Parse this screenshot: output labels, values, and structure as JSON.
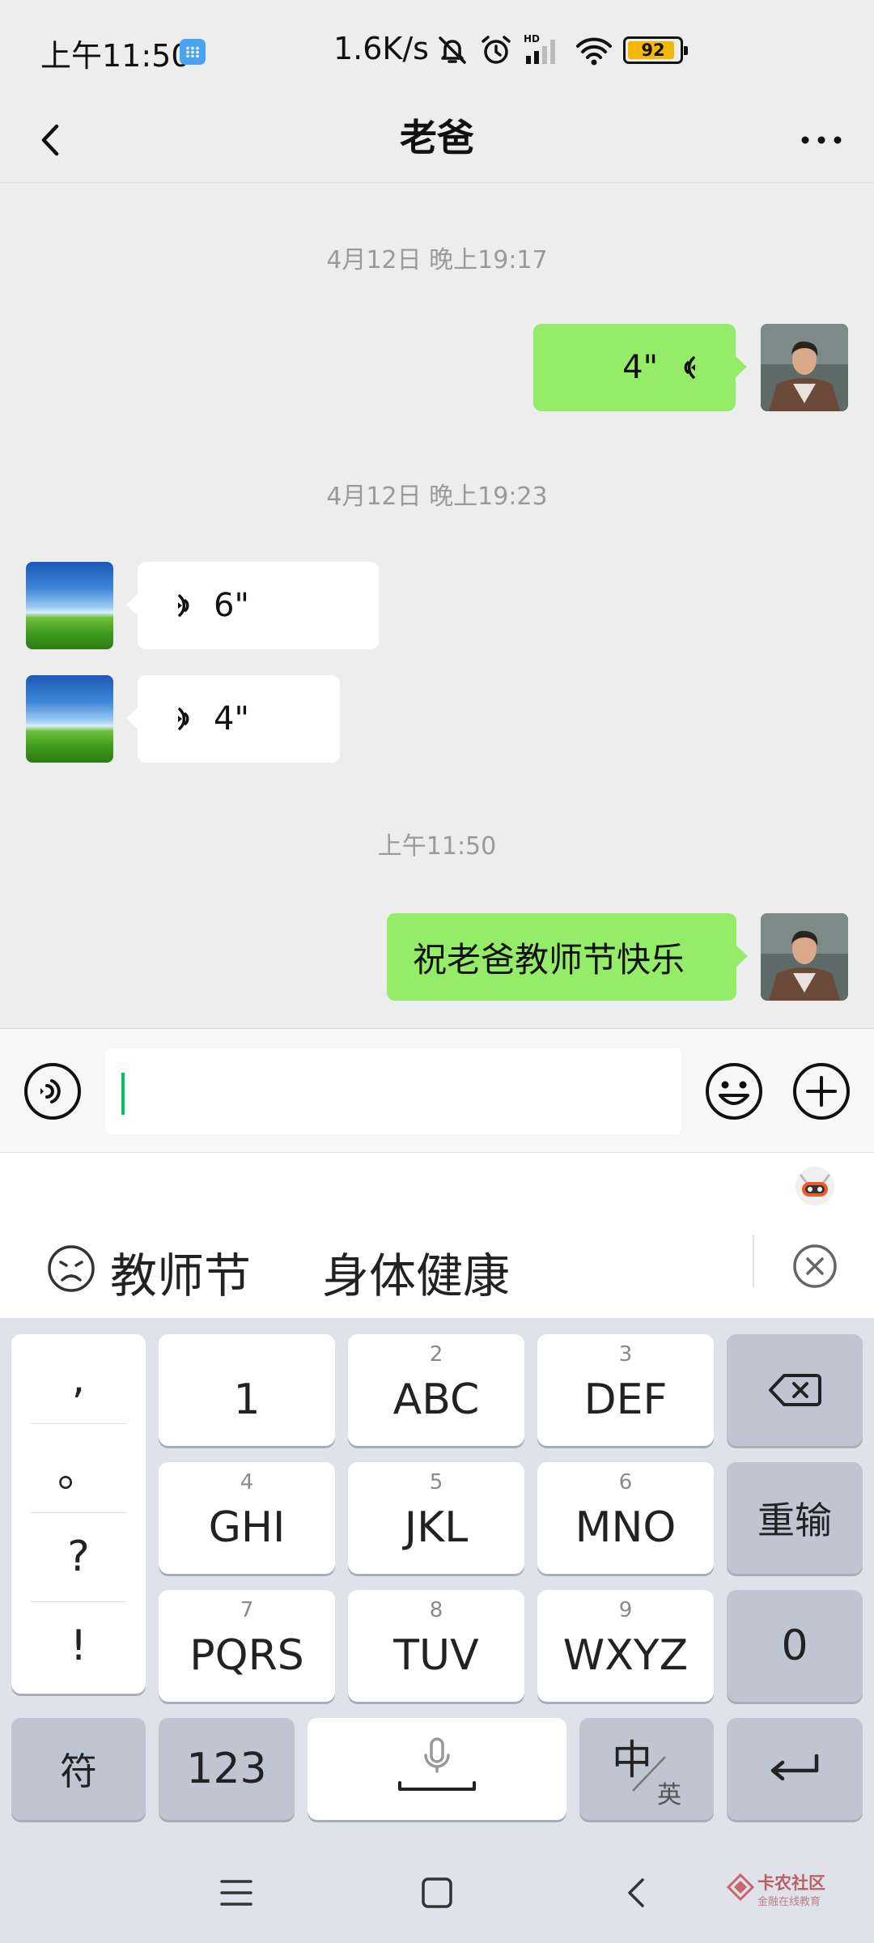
{
  "status_bar": {
    "time": "上午11:50",
    "network_speed": "1.6K/s",
    "battery": "92",
    "battery_level_percent": 92,
    "icons": [
      "keyboard-app-icon",
      "mute-icon",
      "alarm-icon",
      "hd-icon",
      "signal-icon",
      "wifi-icon",
      "battery-icon"
    ]
  },
  "header": {
    "title": "老爸"
  },
  "messages": {
    "ts1": "4月12日 晚上19:17",
    "m1_duration": "4\"",
    "ts2": "4月12日 晚上19:23",
    "m2_duration": "6\"",
    "m3_duration": "4\"",
    "ts3": "上午11:50",
    "m4_text": "祝老爸教师节快乐"
  },
  "input_bar": {
    "value": ""
  },
  "candidates": {
    "c1": "教师节",
    "c2": "身体健康"
  },
  "keyboard": {
    "punct": [
      ",",
      "。",
      "?",
      "!"
    ],
    "keys": [
      {
        "num": "",
        "letters": "1"
      },
      {
        "num": "2",
        "letters": "ABC"
      },
      {
        "num": "3",
        "letters": "DEF"
      },
      {
        "num": "4",
        "letters": "GHI"
      },
      {
        "num": "5",
        "letters": "JKL"
      },
      {
        "num": "6",
        "letters": "MNO"
      },
      {
        "num": "7",
        "letters": "PQRS"
      },
      {
        "num": "8",
        "letters": "TUV"
      },
      {
        "num": "9",
        "letters": "WXYZ"
      }
    ],
    "reenter": "重输",
    "zero": "0",
    "symbols": "符",
    "numbers": "123",
    "lang_main": "中",
    "lang_sub": "英"
  },
  "watermark": {
    "line1": "卡农社区",
    "line2": "金融在线教育"
  },
  "colors": {
    "bubble_sent": "#95ec69",
    "bubble_received": "#ffffff",
    "chat_background": "#ededed",
    "caret": "#07c160",
    "keyboard_bg": "#dfe2e8",
    "function_key": "#bfc5d1",
    "battery_fill": "#f5b800"
  }
}
